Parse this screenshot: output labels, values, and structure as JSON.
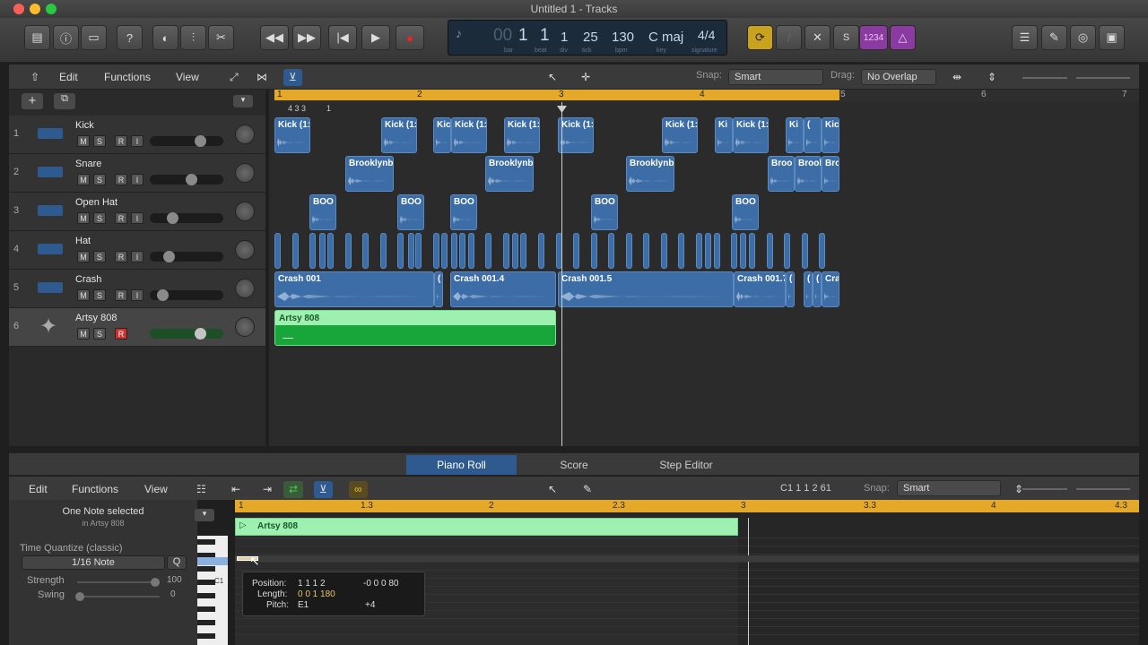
{
  "window": {
    "title": "Untitled 1 - Tracks"
  },
  "lcd": {
    "bar": "1",
    "beat": "1",
    "div": "1",
    "tick": "25",
    "bpm": "130",
    "key": "C maj",
    "signature": "4/4",
    "pre": "00",
    "labels": {
      "bar": "bar",
      "beat": "beat",
      "div": "div",
      "tick": "tick",
      "bpm": "bpm",
      "key": "key",
      "signature": "signature"
    }
  },
  "lcd_mode": "1234",
  "tracks_menu": {
    "edit": "Edit",
    "functions": "Functions",
    "view": "View",
    "snap_label": "Snap:",
    "snap_value": "Smart",
    "drag_label": "Drag:",
    "drag_value": "No Overlap"
  },
  "ruler": {
    "bars": [
      "1",
      "2",
      "3",
      "4",
      "5",
      "6",
      "7"
    ],
    "sub": "4 3 3",
    "sub2": "1"
  },
  "tracks": [
    {
      "num": "1",
      "name": "Kick",
      "m": "M",
      "s": "S",
      "r": "R",
      "i": "I"
    },
    {
      "num": "2",
      "name": "Snare",
      "m": "M",
      "s": "S",
      "r": "R",
      "i": "I"
    },
    {
      "num": "3",
      "name": "Open Hat",
      "m": "M",
      "s": "S",
      "r": "R",
      "i": "I"
    },
    {
      "num": "4",
      "name": "Hat",
      "m": "M",
      "s": "S",
      "r": "R",
      "i": "I"
    },
    {
      "num": "5",
      "name": "Crash",
      "m": "M",
      "s": "S",
      "r": "R",
      "i": "I"
    },
    {
      "num": "6",
      "name": "Artsy 808",
      "m": "M",
      "s": "S",
      "r": "R"
    }
  ],
  "regions": {
    "kick": "Kick (1:",
    "snare": "Brooklynb",
    "open": "BOO",
    "snare_short1": "Broo",
    "snare_short2": "Brool",
    "snare_short3": "Bro",
    "crash1": "Crash 001",
    "crash2": "Crash 001.4",
    "crash3": "Crash 001.5",
    "crash4": "Crash 001.7",
    "crash5": "Cra",
    "artsy": "Artsy 808",
    "small": "(",
    "kick_short": "Ki",
    "kick_short2": "Kic"
  },
  "bottom_tabs": {
    "piano": "Piano Roll",
    "score": "Score",
    "step": "Step Editor"
  },
  "piano_menu": {
    "edit": "Edit",
    "functions": "Functions",
    "view": "View",
    "position": "C1   1 1 2 61",
    "snap_label": "Snap:",
    "snap_value": "Smart"
  },
  "inspector": {
    "selected": "One Note selected",
    "in_region": "in Artsy 808",
    "quantize_label": "Time Quantize (classic)",
    "quantize_value": "1/16 Note",
    "q": "Q",
    "strength_label": "Strength",
    "strength_value": "100",
    "swing_label": "Swing",
    "swing_value": "0",
    "key_label": "C1"
  },
  "pr_ruler": {
    "marks": [
      "1",
      "1.3",
      "2",
      "2.3",
      "3",
      "3.3",
      "4",
      "4.3"
    ]
  },
  "pr_region": "Artsy 808",
  "tooltip": {
    "position_label": "Position:",
    "position": "1 1 1 2",
    "position_delta": "-0 0 0 80",
    "length_label": "Length:",
    "length": "0 0 1 180",
    "pitch_label": "Pitch:",
    "pitch": "E1",
    "pitch_delta": "+4"
  }
}
